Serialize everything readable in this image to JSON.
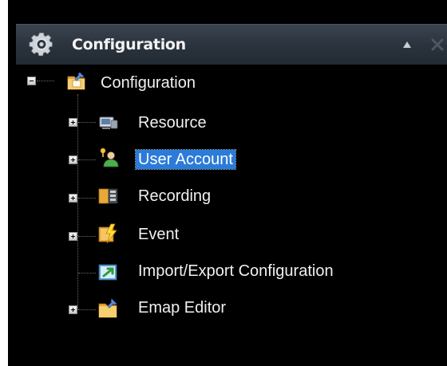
{
  "panel": {
    "title": "Configuration",
    "icon": "gear-icon",
    "collapse_icon": "collapse-up-icon",
    "close_icon": "close-icon",
    "header_color": "#2d3540",
    "selection_color": "#2b7bd9"
  },
  "tree": {
    "root": {
      "label": "Configuration",
      "icon": "configuration-folder-icon",
      "expanded": true
    },
    "children": [
      {
        "label": "Resource",
        "icon": "resource-icon",
        "has_children": true,
        "selected": false
      },
      {
        "label": "User Account",
        "icon": "user-account-icon",
        "has_children": true,
        "selected": true
      },
      {
        "label": "Recording",
        "icon": "recording-icon",
        "has_children": true,
        "selected": false
      },
      {
        "label": "Event",
        "icon": "event-icon",
        "has_children": true,
        "selected": false
      },
      {
        "label": "Import/Export Configuration",
        "icon": "import-export-icon",
        "has_children": false,
        "selected": false
      },
      {
        "label": "Emap Editor",
        "icon": "emap-editor-icon",
        "has_children": true,
        "selected": false
      }
    ]
  }
}
